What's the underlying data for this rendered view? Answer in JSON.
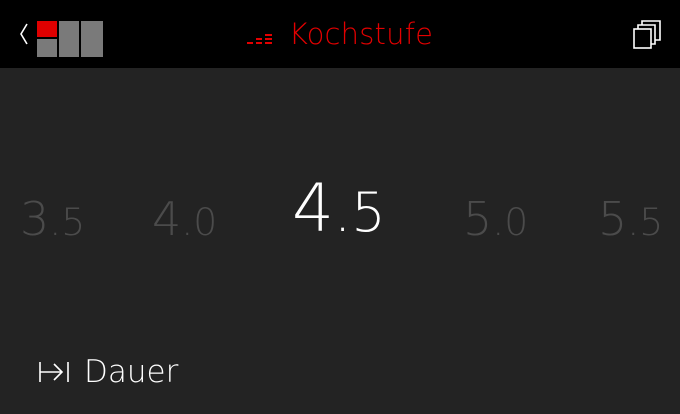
{
  "topbar": {
    "title": "Kochstufe",
    "back_icon": "chevron-left-icon",
    "zones_icon": "cooking-zones-icon",
    "level_icon": "heat-level-icon",
    "windows_icon": "multi-window-icon"
  },
  "levels": {
    "options": [
      {
        "int": "3",
        "frac": ".5"
      },
      {
        "int": "4",
        "frac": ".0"
      },
      {
        "int": "4",
        "frac": ".5"
      },
      {
        "int": "5",
        "frac": ".0"
      },
      {
        "int": "5",
        "frac": ".5"
      }
    ],
    "selected_index": 2
  },
  "duration": {
    "icon": "timer-end-icon",
    "label": "Dauer"
  },
  "colors": {
    "accent": "#e30000",
    "background": "#232323",
    "topbar": "#000000",
    "inactive_value": "#4b4b4b",
    "active_value": "#ffffff"
  }
}
